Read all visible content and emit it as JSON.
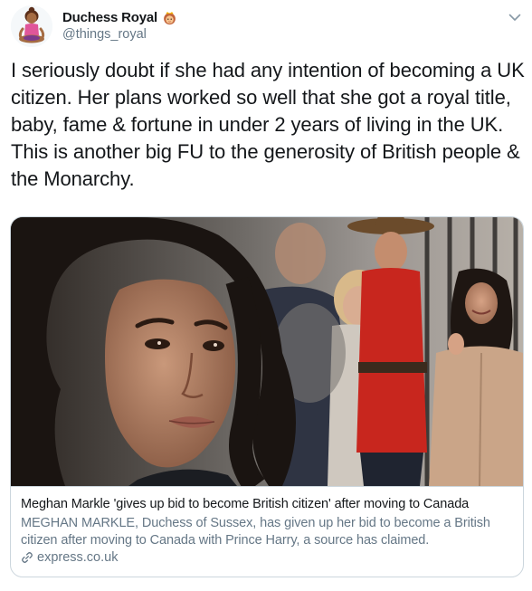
{
  "author": {
    "display_name": "Duchess Royal",
    "handle": "@things_royal",
    "avatar_icon": "meditating-woman-emoji",
    "name_badge_icon": "princess-emoji"
  },
  "tweet": {
    "text": "I seriously doubt if she had any intention of becoming a UK citizen. Her plans worked so well that she got a royal title, baby, fame & fortune in under 2 years of living in the UK. This is another big FU to the generosity of British people & the Monarchy."
  },
  "menu": {
    "icon": "chevron-down-icon"
  },
  "card": {
    "title": "Meghan Markle 'gives up bid to become British citizen' after moving to Canada",
    "description": "MEGHAN MARKLE, Duchess of Sussex, has given up her bid to become a British citizen after moving to Canada with Prince Harry, a source has claimed.",
    "domain": "express.co.uk",
    "domain_icon": "link-icon",
    "image_icon": "news-photo-collage"
  },
  "colors": {
    "text_primary": "#14171a",
    "text_secondary": "#657786",
    "border": "#ccd6dd",
    "mountie_red": "#c8261e"
  }
}
